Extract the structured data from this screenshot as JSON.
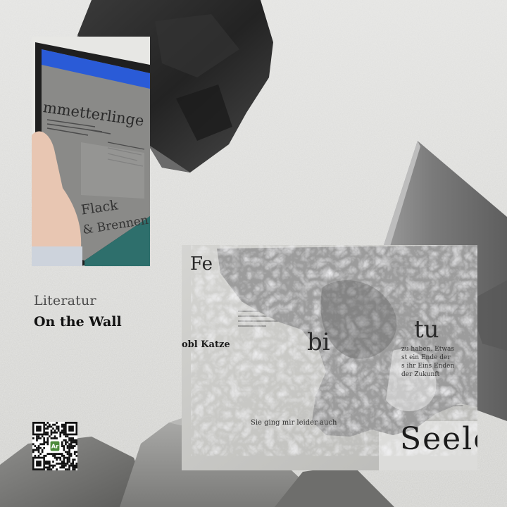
{
  "caption": {
    "kicker": "Literatur",
    "title": "On the Wall"
  },
  "tablet_photo": {
    "words": [
      "mmetterlinge",
      "Flack",
      "& Brennen"
    ]
  },
  "poster_photo": {
    "words": [
      "Fe",
      "bi",
      "tu",
      "obl Katze",
      "Seele",
      "Sie ging mir leider auch"
    ],
    "small_lines": [
      "zu haben. Etwas",
      "st ein Ende der",
      "s ihr Eins Enden",
      "der Zukunft"
    ]
  },
  "qr": {
    "logo_text": "Ar",
    "colors": {
      "logo_bg": "#4c8a3c",
      "logo_fg": "#ffffff"
    }
  },
  "colors": {
    "wall": "#dcdcda",
    "rock_dark": "#2b2b2b",
    "tablet_blue": "#2a5bd7",
    "poster_paper": "#c9c9c6"
  }
}
